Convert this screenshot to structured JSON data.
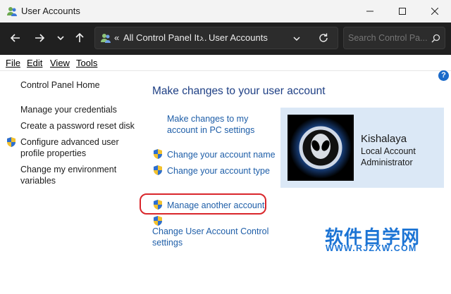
{
  "window": {
    "title": "User Accounts",
    "controls": {
      "minimize": "minimize-icon",
      "maximize": "maximize-icon",
      "close": "close-icon"
    }
  },
  "nav": {
    "back_icon": "arrow-left-icon",
    "forward_icon": "arrow-right-icon",
    "recent_icon": "chevron-down-icon",
    "up_icon": "arrow-up-icon"
  },
  "address": {
    "separator": "«",
    "crumbs": [
      "All Control Panel It...",
      "User Accounts"
    ],
    "crumb_sep": "›",
    "refresh_icon": "refresh-icon"
  },
  "search": {
    "placeholder": "Search Control Pa..."
  },
  "menubar": {
    "items": [
      "File",
      "Edit",
      "View",
      "Tools"
    ]
  },
  "sidebar": {
    "home": "Control Panel Home",
    "links": [
      {
        "label": "Manage your credentials",
        "shield": false
      },
      {
        "label": "Create a password reset disk",
        "shield": false
      },
      {
        "label": "Configure advanced user profile properties",
        "shield": true
      },
      {
        "label": "Change my environment variables",
        "shield": false
      }
    ]
  },
  "main": {
    "heading": "Make changes to your user account",
    "links": {
      "pc_settings": "Make changes to my account in PC settings",
      "change_name": "Change your account name",
      "change_type": "Change your account type",
      "manage_another": "Manage another account",
      "uac": "Change User Account Control settings"
    }
  },
  "user": {
    "name": "Kishalaya",
    "type": "Local Account",
    "role": "Administrator"
  },
  "watermark": {
    "text": "软件自学网",
    "url": "WWW.RJZXW.COM"
  },
  "colors": {
    "link": "#1e5ea8",
    "heading": "#1e3f84",
    "highlight": "#d9262b",
    "userbox": "#dbe8f6",
    "watermark": "#1c74d4"
  }
}
